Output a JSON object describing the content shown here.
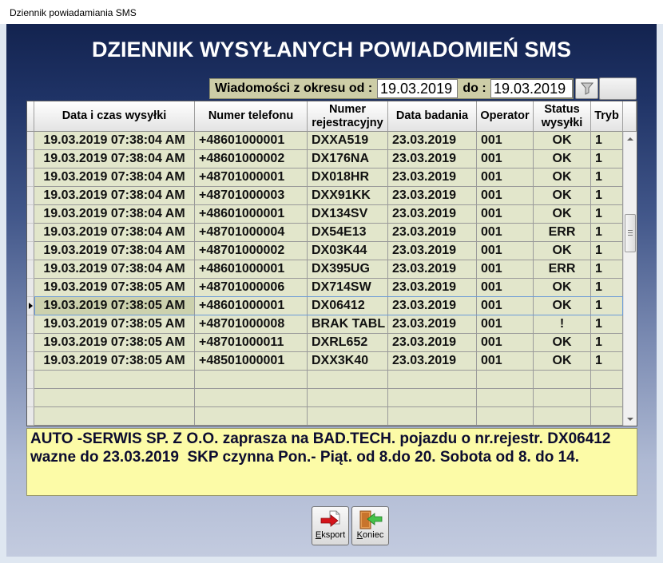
{
  "window": {
    "title": "Dziennik powiadamiania SMS"
  },
  "heading": "DZIENNIK WYSYŁANYCH POWIADOMIEŃ SMS",
  "filter": {
    "from_label": "Wiadomości z okresu od :",
    "from_value": "19.03.2019",
    "to_label": "do :",
    "to_value": "19.03.2019"
  },
  "table": {
    "columns": [
      "Data i czas wysyłki",
      "Numer telefonu",
      "Numer rejestracyjny",
      "Data badania",
      "Operator",
      "Status wysyłki",
      "Tryb"
    ],
    "selected_row": 9,
    "rows": [
      {
        "sent_at": "19.03.2019 07:38:04 AM",
        "phone": "+48601000001",
        "registration": "DXXA519",
        "inspection_date": "23.03.2019",
        "operator": "001",
        "status": "OK",
        "mode": "1"
      },
      {
        "sent_at": "19.03.2019 07:38:04 AM",
        "phone": "+48601000002",
        "registration": "DX176NA",
        "inspection_date": "23.03.2019",
        "operator": "001",
        "status": "OK",
        "mode": "1"
      },
      {
        "sent_at": "19.03.2019 07:38:04 AM",
        "phone": "+48701000001",
        "registration": "DX018HR",
        "inspection_date": "23.03.2019",
        "operator": "001",
        "status": "OK",
        "mode": "1"
      },
      {
        "sent_at": "19.03.2019 07:38:04 AM",
        "phone": "+48701000003",
        "registration": "DXX91KK",
        "inspection_date": "23.03.2019",
        "operator": "001",
        "status": "OK",
        "mode": "1"
      },
      {
        "sent_at": "19.03.2019 07:38:04 AM",
        "phone": "+48601000001",
        "registration": "DX134SV",
        "inspection_date": "23.03.2019",
        "operator": "001",
        "status": "OK",
        "mode": "1"
      },
      {
        "sent_at": "19.03.2019 07:38:04 AM",
        "phone": "+48701000004",
        "registration": "DX54E13",
        "inspection_date": "23.03.2019",
        "operator": "001",
        "status": "ERR",
        "mode": "1"
      },
      {
        "sent_at": "19.03.2019 07:38:04 AM",
        "phone": "+48701000002",
        "registration": "DX03K44",
        "inspection_date": "23.03.2019",
        "operator": "001",
        "status": "OK",
        "mode": "1"
      },
      {
        "sent_at": "19.03.2019 07:38:04 AM",
        "phone": "+48601000001",
        "registration": "DX395UG",
        "inspection_date": "23.03.2019",
        "operator": "001",
        "status": "ERR",
        "mode": "1"
      },
      {
        "sent_at": "19.03.2019 07:38:05 AM",
        "phone": "+48701000006",
        "registration": "DX714SW",
        "inspection_date": "23.03.2019",
        "operator": "001",
        "status": "OK",
        "mode": "1"
      },
      {
        "sent_at": "19.03.2019 07:38:05 AM",
        "phone": "+48601000001",
        "registration": "DX06412",
        "inspection_date": "23.03.2019",
        "operator": "001",
        "status": "OK",
        "mode": "1"
      },
      {
        "sent_at": "19.03.2019 07:38:05 AM",
        "phone": "+48701000008",
        "registration": "BRAK TABL",
        "inspection_date": "23.03.2019",
        "operator": "001",
        "status": "!",
        "mode": "1"
      },
      {
        "sent_at": "19.03.2019 07:38:05 AM",
        "phone": "+48701000011",
        "registration": "DXRL652",
        "inspection_date": "23.03.2019",
        "operator": "001",
        "status": "OK",
        "mode": "1"
      },
      {
        "sent_at": "19.03.2019 07:38:05 AM",
        "phone": "+48501000001",
        "registration": "DXX3K40",
        "inspection_date": "23.03.2019",
        "operator": "001",
        "status": "OK",
        "mode": "1"
      }
    ]
  },
  "message": {
    "lines": [
      "AUTO -SERWIS SP. Z O.O. zaprasza na BAD.TECH. pojazdu o nr.rejestr. DX06412",
      "wazne do 23.03.2019  SKP czynna Pon.- Piąt. od 8.do 20. Sobota od 8. do 14."
    ]
  },
  "buttons": {
    "export_label": "Eksport",
    "end_label": "Koniec"
  },
  "icons": {
    "filter_button": "funnel-icon",
    "export_button": "export-arrow-icon",
    "end_button": "exit-door-icon",
    "selected_row": "current-row-indicator-icon"
  },
  "colors": {
    "grid_row": "#e2e6cb",
    "message_box": "#fcfba7",
    "filter_strip": "#cdcda7",
    "selection_outline": "#6b9bd8"
  }
}
